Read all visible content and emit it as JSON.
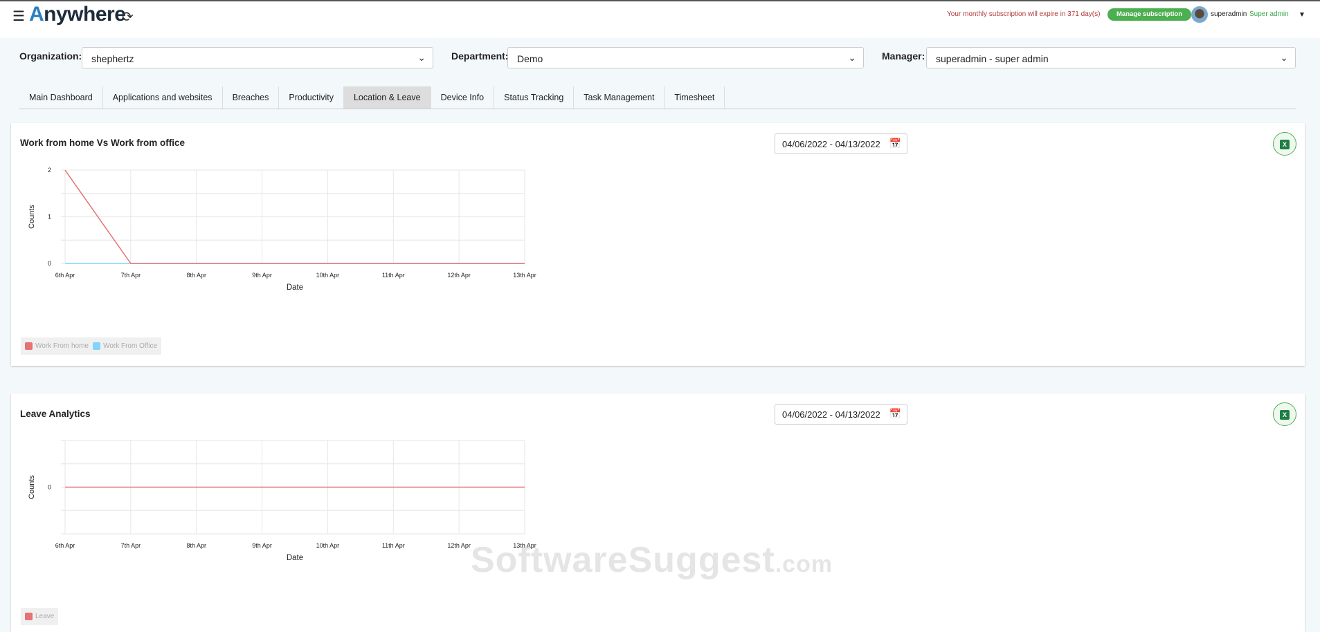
{
  "header": {
    "app_name_first": "A",
    "app_name_rest": "nywhere",
    "subscription_notice": "Your monthly subscription will expire in 371 day(s)",
    "manage_label": "Manage subscription",
    "username": "superadmin",
    "role": "Super admin"
  },
  "filters": {
    "organization_label": "Organization:",
    "organization_value": "shephertz",
    "department_label": "Department:",
    "department_value": "Demo",
    "manager_label": "Manager:",
    "manager_value": "superadmin - super admin"
  },
  "tabs": [
    {
      "label": "Main Dashboard"
    },
    {
      "label": "Applications and websites"
    },
    {
      "label": "Breaches"
    },
    {
      "label": "Productivity"
    },
    {
      "label": "Location & Leave",
      "active": true
    },
    {
      "label": "Device Info"
    },
    {
      "label": "Status Tracking"
    },
    {
      "label": "Task Management"
    },
    {
      "label": "Timesheet"
    }
  ],
  "cards": [
    {
      "title": "Work from home Vs Work from office",
      "date_range": "04/06/2022 - 04/13/2022"
    },
    {
      "title": "Leave Analytics",
      "date_range": "04/06/2022 - 04/13/2022"
    }
  ],
  "watermark": {
    "main": "SoftwareSuggest",
    ".com": ".com"
  },
  "chart_data": [
    {
      "type": "line",
      "title": "Work from home Vs Work from office",
      "xlabel": "Date",
      "ylabel": "Counts",
      "categories": [
        "6th Apr",
        "7th Apr",
        "8th Apr",
        "9th Apr",
        "10th Apr",
        "11th Apr",
        "12th Apr",
        "13th Apr"
      ],
      "yticks": [
        "0",
        "1",
        "2"
      ],
      "ylim": [
        0,
        2
      ],
      "legend": "bottom-left",
      "series": [
        {
          "name": "Work From home",
          "color": "#e57373",
          "values": [
            2,
            0,
            0,
            0,
            0,
            0,
            0,
            0
          ]
        },
        {
          "name": "Work From Office",
          "color": "#81d4fa",
          "values": [
            0,
            0,
            0,
            0,
            0,
            0,
            0,
            0
          ]
        }
      ]
    },
    {
      "type": "line",
      "title": "Leave Analytics",
      "xlabel": "Date",
      "ylabel": "Counts",
      "categories": [
        "6th Apr",
        "7th Apr",
        "8th Apr",
        "9th Apr",
        "10th Apr",
        "11th Apr",
        "12th Apr",
        "13th Apr"
      ],
      "yticks": [
        "0"
      ],
      "ylim": [
        -1,
        1
      ],
      "legend": "bottom-left",
      "series": [
        {
          "name": "Leave",
          "color": "#e57373",
          "values": [
            0,
            0,
            0,
            0,
            0,
            0,
            0,
            0
          ]
        }
      ]
    }
  ]
}
